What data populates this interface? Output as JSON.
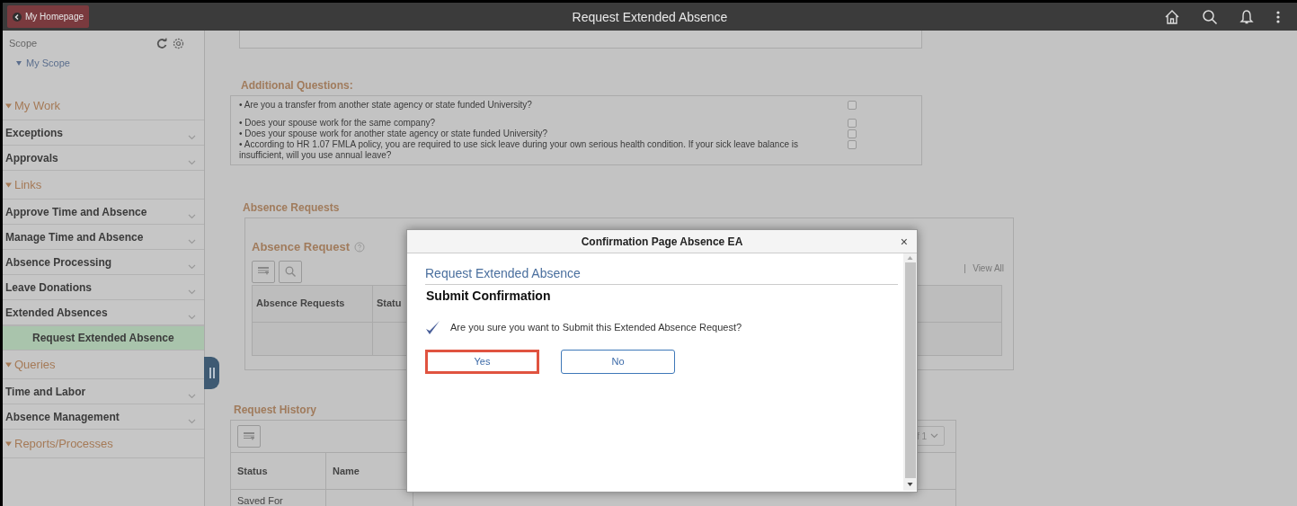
{
  "header": {
    "back_button": "My Homepage",
    "title": "Request Extended Absence"
  },
  "sidebar": {
    "scope_label": "Scope",
    "scope_link": "My Scope",
    "sections": [
      {
        "title": "My Work",
        "expanded": true,
        "items": [
          {
            "label": "Exceptions",
            "selected": false
          },
          {
            "label": "Approvals",
            "selected": false
          }
        ]
      },
      {
        "title": "Links",
        "expanded": true,
        "items": [
          {
            "label": "Approve Time and Absence",
            "selected": false
          },
          {
            "label": "Manage Time and Absence",
            "selected": false
          },
          {
            "label": "Absence Processing",
            "selected": false
          },
          {
            "label": "Leave Donations",
            "selected": false
          },
          {
            "label": "Extended Absences",
            "selected": false,
            "children": [
              {
                "label": "Request Extended Absence",
                "selected": true
              }
            ]
          }
        ]
      },
      {
        "title": "Queries",
        "expanded": true,
        "items": [
          {
            "label": "Time and Labor",
            "selected": false
          },
          {
            "label": "Absence Management",
            "selected": false
          }
        ]
      },
      {
        "title": "Reports/Processes",
        "expanded": true
      }
    ]
  },
  "additional_questions": {
    "title": "Additional Questions:",
    "questions": [
      {
        "text": "• Are you a transfer from another state agency or state funded University?",
        "checked": false
      },
      {
        "text": "• Does your spouse work for the same company?",
        "checked": false
      },
      {
        "text": "• Does your spouse work for another state agency or state funded University?",
        "checked": false
      },
      {
        "text": "• According to HR 1.07 FMLA policy, you are required to use sick leave during your own serious health condition. If your sick leave balance is insufficient, will you use annual leave?",
        "checked": false
      }
    ]
  },
  "absence_requests": {
    "title": "Absence Requests",
    "grid_title": "Absence Request",
    "pager": "View All",
    "columns": [
      "Absence Requests",
      "Statu"
    ]
  },
  "request_history": {
    "title": "Request History",
    "pager": "f 1",
    "columns": [
      "Status",
      "Name"
    ],
    "rows": [
      [
        "Saved For"
      ]
    ]
  },
  "dialog": {
    "title": "Confirmation Page Absence EA",
    "close": "×",
    "heading": "Request Extended Absence",
    "subheading": "Submit Confirmation",
    "message": "Are you sure you want to Submit this Extended Absence Request?",
    "buttons": [
      {
        "label": "Yes",
        "focused": true
      },
      {
        "label": "No",
        "focused": false
      }
    ]
  }
}
